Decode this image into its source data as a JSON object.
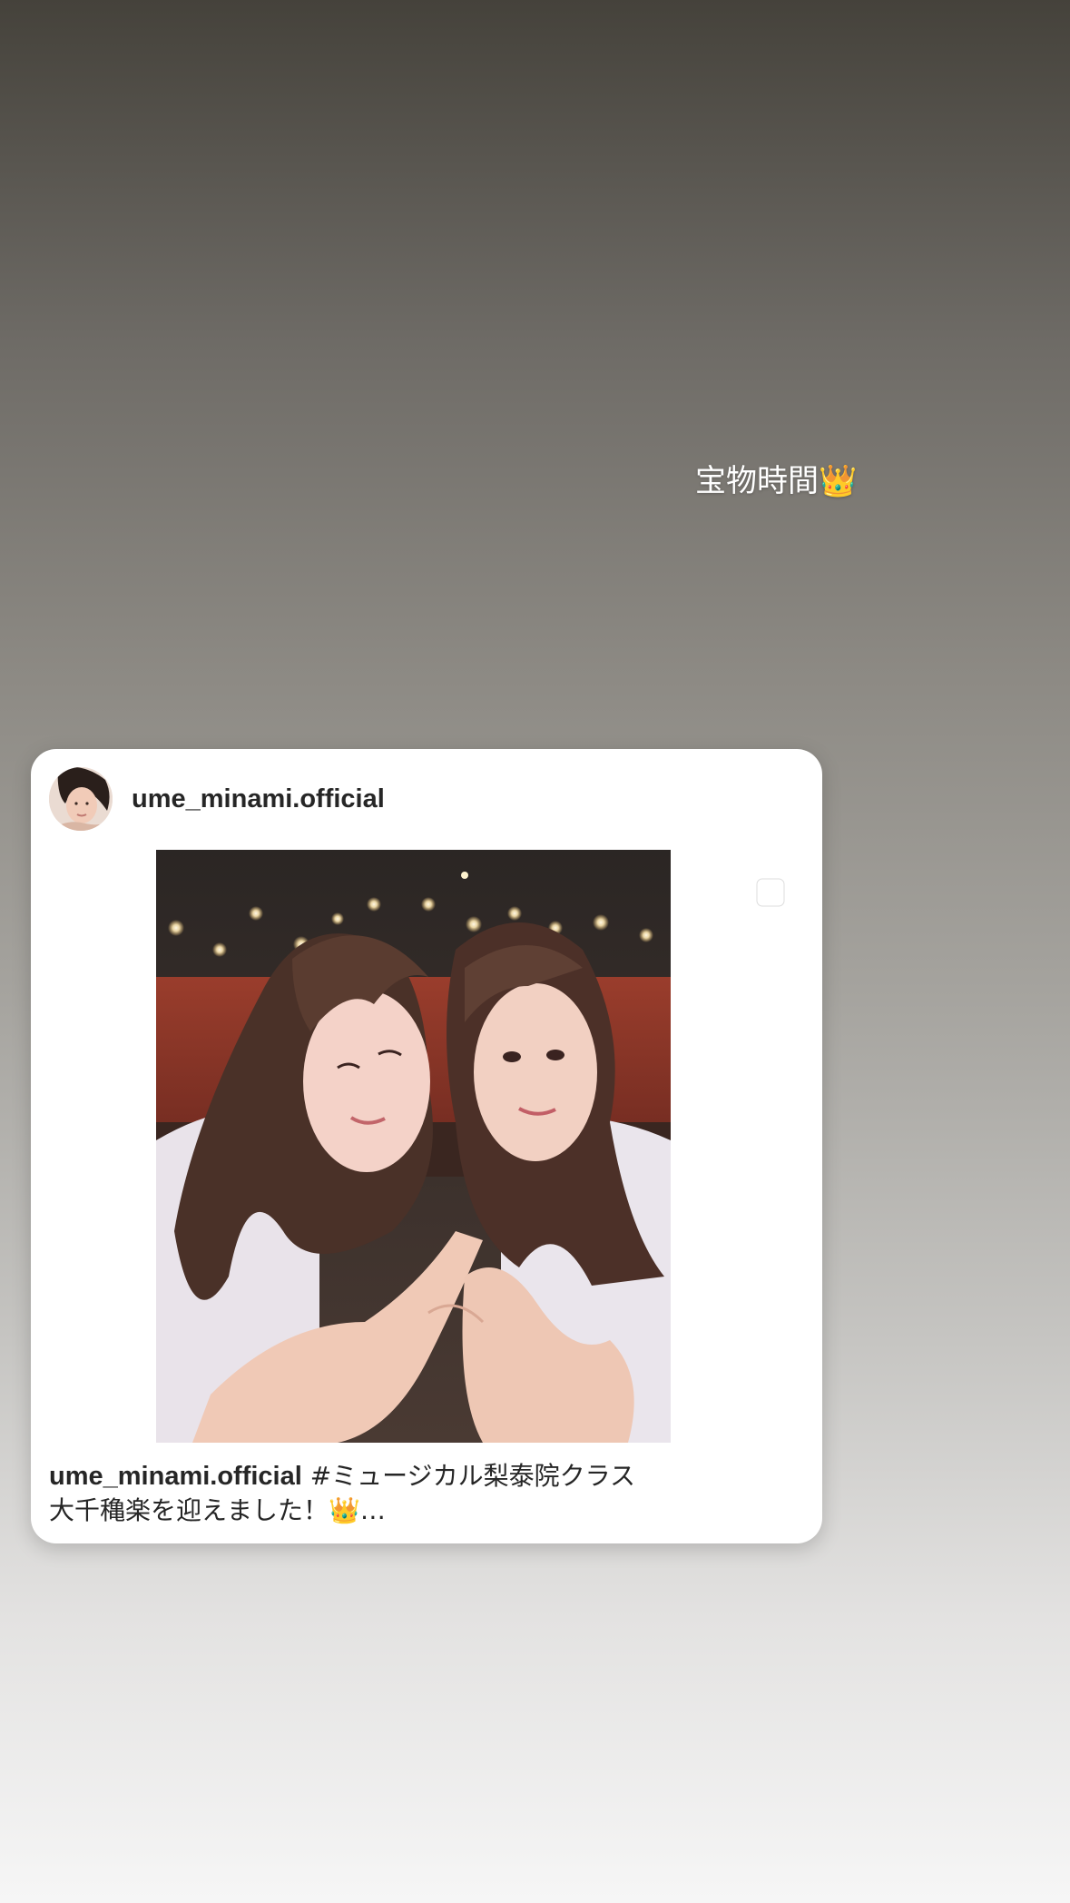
{
  "story": {
    "sticker_text": "宝物時間👑"
  },
  "post": {
    "username": "ume_minami.official",
    "caption_username": "ume_minami.official",
    "caption_line1": "#ミュージカル梨泰院クラス",
    "caption_line2": "大千穐楽を迎えました！👑…"
  },
  "icons": {
    "multi_post": "carousel-icon",
    "avatar": "profile-avatar"
  }
}
